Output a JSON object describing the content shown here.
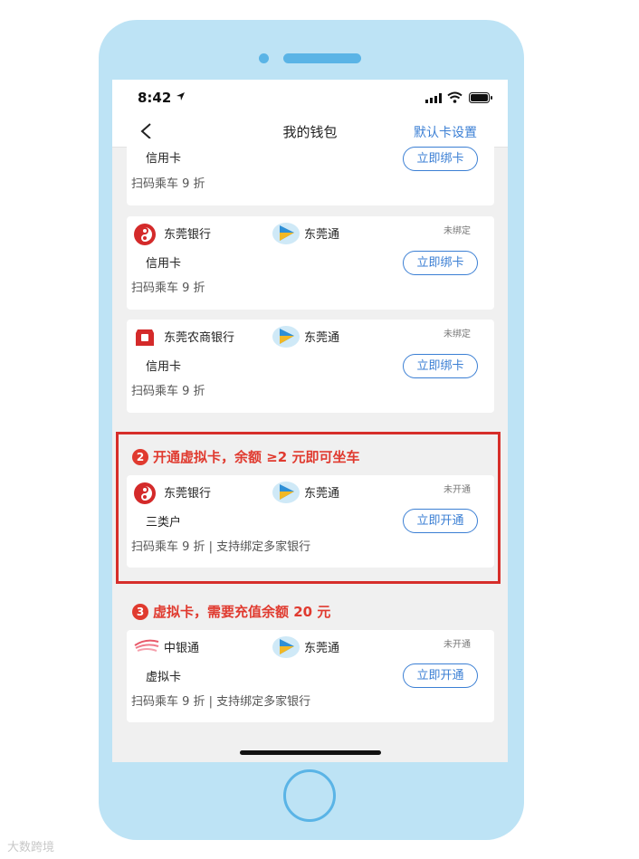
{
  "status_bar": {
    "time": "8:42"
  },
  "nav": {
    "title": "我的钱包",
    "right_action": "默认卡设置"
  },
  "cards_top": [
    {
      "card_type": "信用卡",
      "button": "立即绑卡",
      "desc": "扫码乘车 9 折"
    },
    {
      "bank": "东莞银行",
      "transit": "东莞通",
      "status": "未绑定",
      "card_type": "信用卡",
      "button": "立即绑卡",
      "desc": "扫码乘车 9 折"
    },
    {
      "bank": "东莞农商银行",
      "transit": "东莞通",
      "status": "未绑定",
      "card_type": "信用卡",
      "button": "立即绑卡",
      "desc": "扫码乘车 9 折"
    }
  ],
  "section2": {
    "number": "2",
    "title": "开通虚拟卡，余额 ≥2 元即可坐车",
    "card": {
      "bank": "东莞银行",
      "transit": "东莞通",
      "status": "未开通",
      "card_type": "三类户",
      "button": "立即开通",
      "desc": "扫码乘车 9 折 | 支持绑定多家银行"
    }
  },
  "section3": {
    "number": "3",
    "title": "虚拟卡，需要充值余额 20 元",
    "card": {
      "bank": "中银通",
      "transit": "东莞通",
      "status": "未开通",
      "card_type": "虚拟卡",
      "button": "立即开通",
      "desc": "扫码乘车 9 折 | 支持绑定多家银行"
    }
  },
  "watermark": "大数跨境",
  "icons": {
    "dongguan_bank": "dongguan-bank-logo",
    "rural_bank": "dongguan-rural-bank-logo",
    "bocpay": "zhongyintong-logo",
    "transit": "dongguantong-logo"
  },
  "colors": {
    "accent": "#3b7fd4",
    "highlight": "#e03a2f",
    "phone": "#bde3f5"
  }
}
